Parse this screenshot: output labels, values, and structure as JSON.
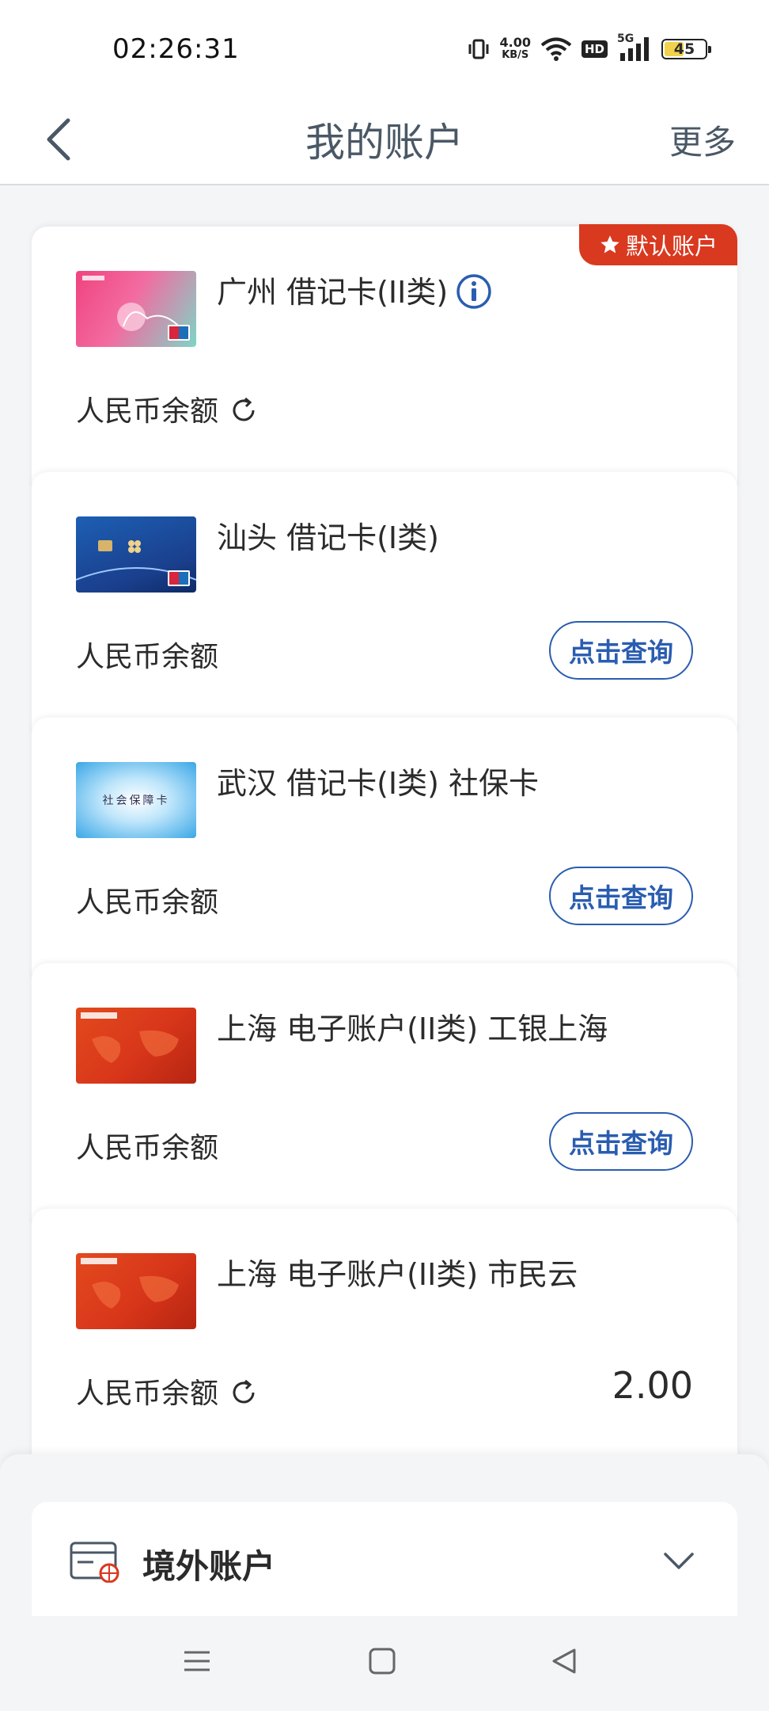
{
  "status_bar": {
    "time": "02:26:31",
    "speed_value": "4.00",
    "speed_unit": "KB/S",
    "hd": "HD",
    "network": "5G",
    "battery": "45"
  },
  "header": {
    "title": "我的账户",
    "more": "更多"
  },
  "accounts": [
    {
      "title": "广州 借记卡(II类)",
      "balance_label": "人民币余额",
      "default_badge": "默认账户",
      "card_style": "pink"
    },
    {
      "title": "汕头 借记卡(I类)",
      "balance_label": "人民币余额",
      "query_label": "点击查询",
      "card_style": "blue"
    },
    {
      "title": "武汉 借记卡(I类)  社保卡",
      "balance_label": "人民币余额",
      "query_label": "点击查询",
      "card_style": "social",
      "card_text": "社会保障卡"
    },
    {
      "title": "上海 电子账户(II类) 工银上海",
      "balance_label": "人民币余额",
      "query_label": "点击查询",
      "card_style": "red"
    },
    {
      "title": "上海 电子账户(II类) 市民云",
      "balance_label": "人民币余额",
      "amount": "2.00",
      "card_style": "red"
    }
  ],
  "overseas": {
    "label": "境外账户"
  },
  "colors": {
    "accent_blue": "#2a5db0",
    "badge_red": "#d9391f",
    "title_gray": "#4a5866"
  }
}
